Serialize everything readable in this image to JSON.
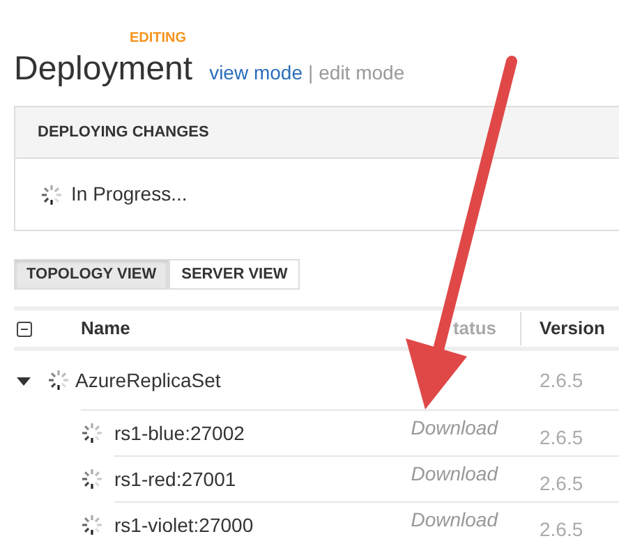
{
  "header": {
    "badge": "EDITING",
    "title": "Deployment",
    "links": [
      {
        "label": "view mode",
        "selected": false
      },
      {
        "label": "edit mode",
        "selected": true
      }
    ],
    "separator": "|"
  },
  "panel": {
    "title": "DEPLOYING CHANGES",
    "status": "In Progress..."
  },
  "tabs": [
    {
      "label": "TOPOLOGY VIEW",
      "selected": true
    },
    {
      "label": "SERVER VIEW",
      "selected": false
    }
  ],
  "table": {
    "columns": [
      "Name",
      "tatus",
      "Version"
    ],
    "rows": [
      {
        "name": "AzureReplicaSet",
        "status": "",
        "version": "2.6.5",
        "expanded": true,
        "children": [
          {
            "name": "rs1-blue:27002",
            "status": "Download",
            "version": "2.6.5"
          },
          {
            "name": "rs1-red:27001",
            "status": "Download",
            "version": "2.6.5"
          },
          {
            "name": "rs1-violet:27000",
            "status": "Download",
            "version": "2.6.5"
          }
        ]
      }
    ]
  }
}
